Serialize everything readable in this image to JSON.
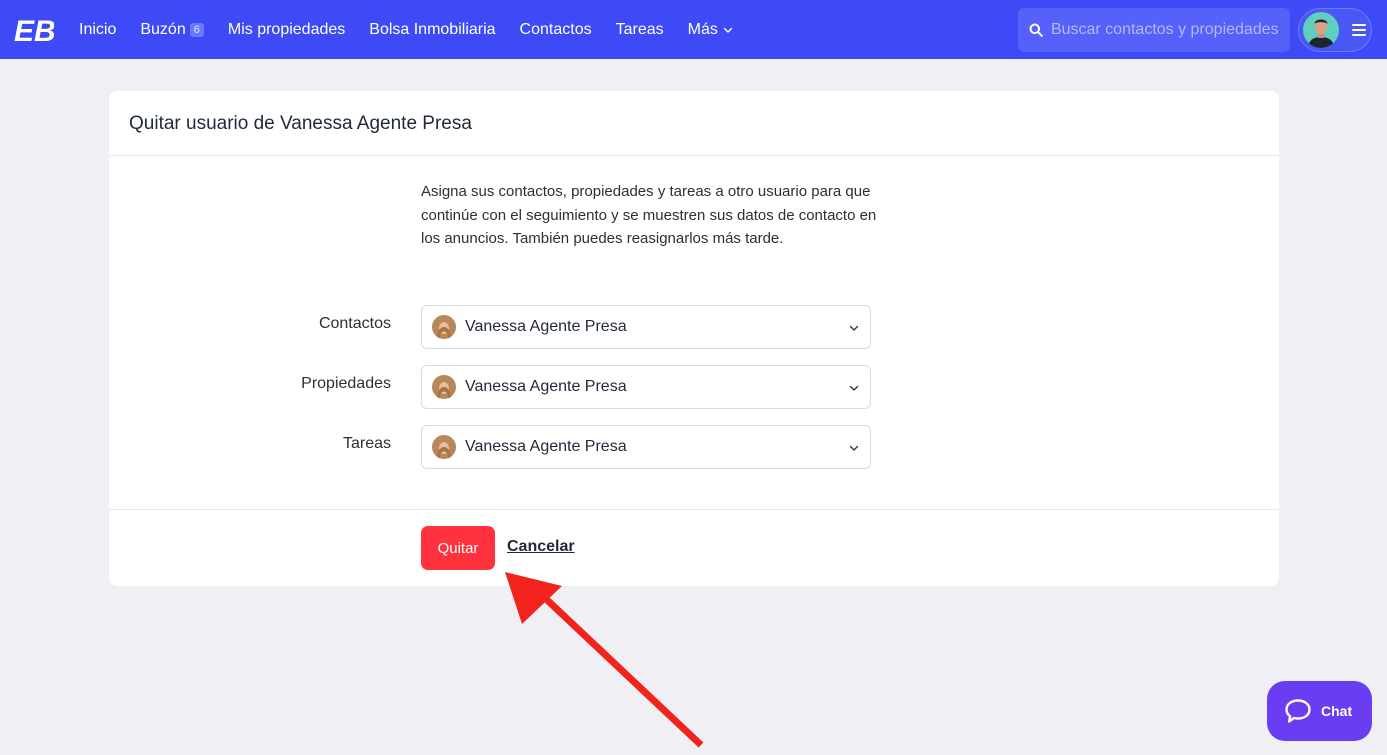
{
  "nav": {
    "logo_text": "EB",
    "items": [
      {
        "label": "Inicio"
      },
      {
        "label": "Buzón",
        "badge": "6"
      },
      {
        "label": "Mis propiedades"
      },
      {
        "label": "Bolsa Inmobiliaria"
      },
      {
        "label": "Contactos"
      },
      {
        "label": "Tareas"
      },
      {
        "label": "Más"
      }
    ],
    "search_placeholder": "Buscar contactos y propiedades"
  },
  "card": {
    "title": "Quitar usuario de Vanessa Agente Presa",
    "description": "Asigna sus contactos, propiedades y tareas a otro usuario para que continúe con el seguimiento y se muestren sus datos de contacto en los anuncios. También puedes reasignarlos más tarde.",
    "fields": [
      {
        "label": "Contactos",
        "value": "Vanessa Agente Presa"
      },
      {
        "label": "Propiedades",
        "value": "Vanessa Agente Presa"
      },
      {
        "label": "Tareas",
        "value": "Vanessa Agente Presa"
      }
    ],
    "submit_label": "Quitar",
    "cancel_label": "Cancelar"
  },
  "chat": {
    "label": "Chat"
  },
  "colors": {
    "nav_bg": "#3d4af6",
    "danger": "#ff323d",
    "chat_bg": "#6a3df3",
    "annotation_arrow": "#f2231d"
  }
}
